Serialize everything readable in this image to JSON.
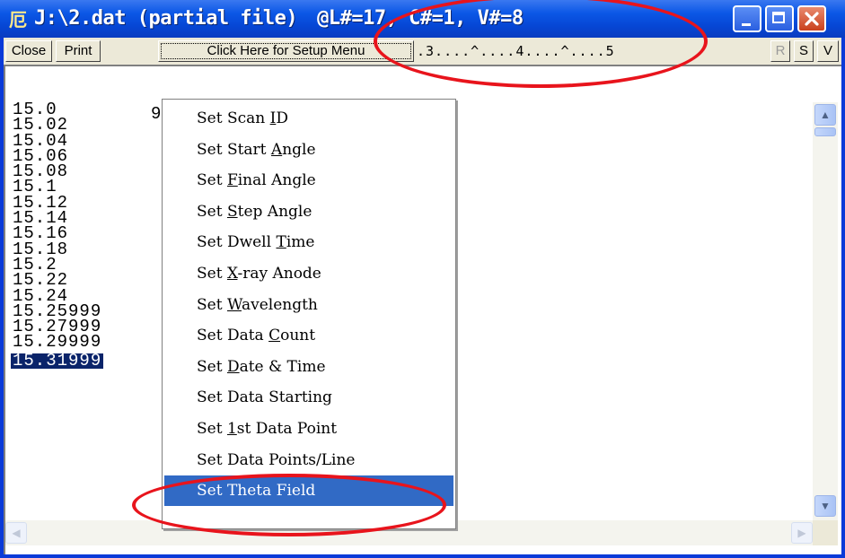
{
  "window": {
    "icon_glyph": "厄",
    "title_path": "J:\\2.dat",
    "title_partial": "(partial file)",
    "title_status": "@L#=17, C#=1, V#=8"
  },
  "toolbar": {
    "close_label": "Close",
    "print_label": "Print",
    "setup_label": "Click Here for Setup Menu",
    "ruler": ".3....^....4....^....5",
    "r_label": "R",
    "s_label": "S",
    "v_label": "V"
  },
  "data_column": [
    "15.0",
    "15.02",
    "15.04",
    "15.06",
    "15.08",
    "15.1",
    "15.12",
    "15.14",
    "15.16",
    "15.18",
    "15.2",
    "15.22",
    "15.24",
    "15.25999",
    "15.27999",
    "15.29999",
    "15.31999"
  ],
  "selected_value": "15.31999",
  "second_column_first": "9",
  "menu": {
    "items": [
      {
        "pre": "Set Scan ",
        "key": "I",
        "post": "D"
      },
      {
        "pre": "Set Start ",
        "key": "A",
        "post": "ngle"
      },
      {
        "pre": "Set ",
        "key": "F",
        "post": "inal Angle"
      },
      {
        "pre": "Set ",
        "key": "S",
        "post": "tep Angle"
      },
      {
        "pre": "Set Dwell ",
        "key": "T",
        "post": "ime"
      },
      {
        "pre": "Set ",
        "key": "X",
        "post": "-ray Anode"
      },
      {
        "pre": "Set ",
        "key": "W",
        "post": "avelength"
      },
      {
        "pre": "Set Data ",
        "key": "C",
        "post": "ount"
      },
      {
        "pre": "Set ",
        "key": "D",
        "post": "ate & Time"
      },
      {
        "pre": "Set Data Starting",
        "key": "",
        "post": ""
      },
      {
        "pre": "Set ",
        "key": "1",
        "post": "st Data Point"
      },
      {
        "pre": "Set Data Points/Line",
        "key": "",
        "post": ""
      },
      {
        "pre": "Set Theta Field",
        "key": "",
        "post": ""
      }
    ],
    "active_index": 12
  },
  "colors": {
    "titlebar": "#0646d4",
    "menu_highlight": "#316ac5",
    "annotation": "#e8141c"
  }
}
